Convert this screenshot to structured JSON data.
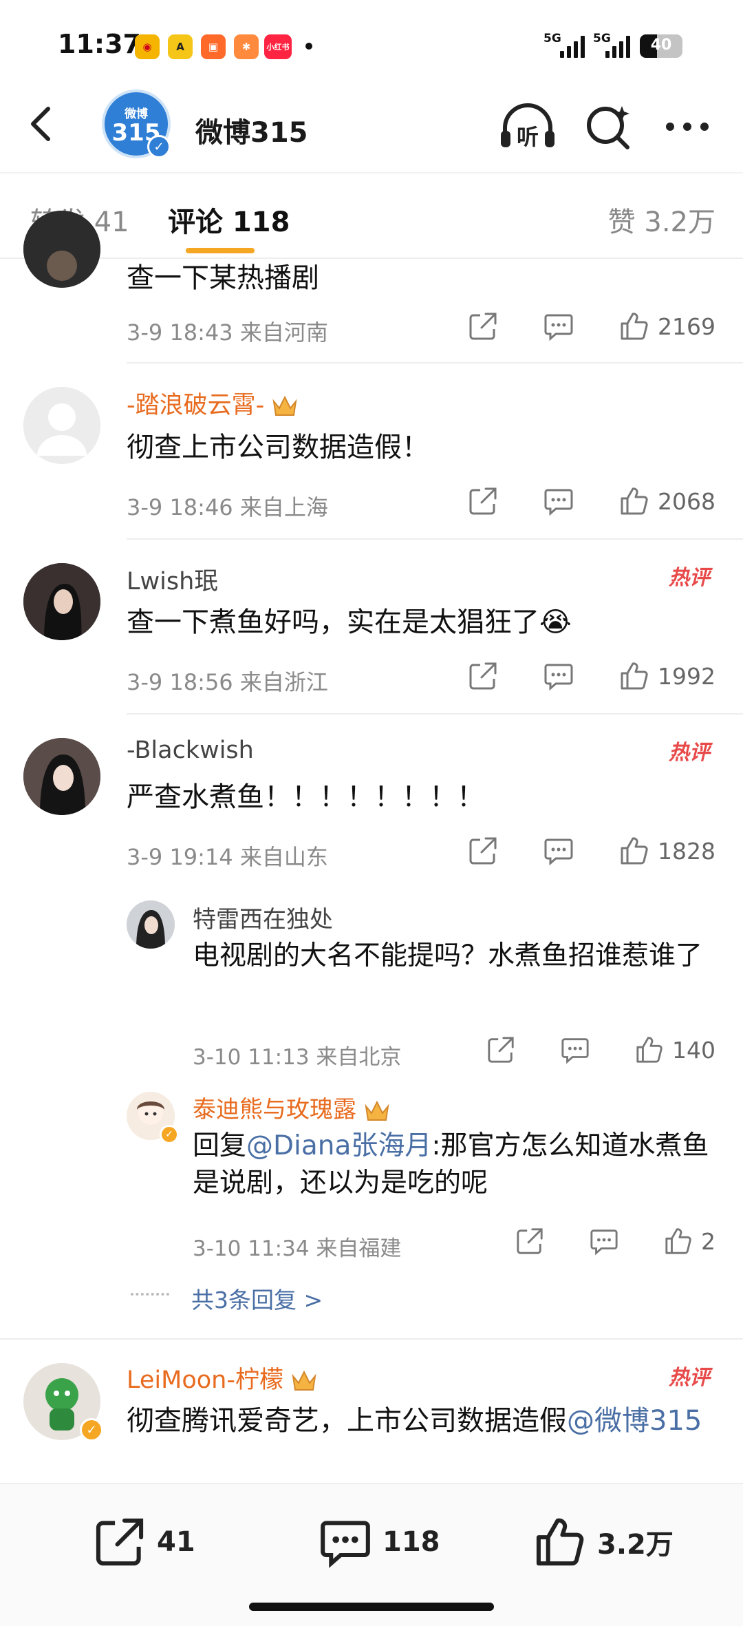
{
  "status_bar": {
    "time": "11:37",
    "sig1": "5G",
    "sig2": "5G",
    "battery": "40",
    "battery_level": 0.4,
    "mini_app_label": "小红书"
  },
  "nav": {
    "title": "微博315",
    "badge_line1": "微博",
    "badge_line2": "315",
    "icons": [
      "back-icon",
      "headphones-listen-icon",
      "search-sparkle-icon",
      "more-icon"
    ],
    "listen_label": "听"
  },
  "tabs": {
    "repost": "转发 41",
    "comment": "评论 118",
    "likes": "赞 3.2万"
  },
  "comments": [
    {
      "name": "",
      "text": "查一下某热播剧",
      "meta": "3-9 18:43  来自河南",
      "likes": "2169",
      "hot": false
    },
    {
      "name": "-踏浪破云霄-",
      "text": "彻查上市公司数据造假！",
      "meta": "3-9 18:46  来自上海",
      "likes": "2068",
      "hot": false
    },
    {
      "name": "Lwish珉",
      "text": "查一下煮鱼好吗，实在是太猖狂了😭",
      "meta": "3-9 18:56  来自浙江",
      "likes": "1992",
      "hot": true
    },
    {
      "name": "-Blackwish",
      "text": "严查水煮鱼！！！！！！！！",
      "meta": "3-9 19:14  来自山东",
      "likes": "1828",
      "hot": true
    },
    {
      "name": "LeiMoon-柠檬",
      "text_prefix": "彻查腾讯爱奇艺，上市公司数据造假",
      "text_mention": "@微博315",
      "hot": true
    }
  ],
  "replies": [
    {
      "name": "特雷西在独处",
      "text": "电视剧的大名不能提吗？水煮鱼招谁惹谁了",
      "meta": "3-10 11:13  来自北京",
      "likes": "140"
    },
    {
      "name": "泰迪熊与玫瑰露",
      "reply_prefix": "回复",
      "mention": "@Diana张海月",
      "text": ":那官方怎么知道水煮鱼是说剧，还以为是吃的呢",
      "meta": "3-10 11:34  来自福建",
      "likes": "2"
    }
  ],
  "hot_label": "热评",
  "more_replies": "共3条回复 >",
  "bottom_bar": {
    "repost": "41",
    "comment": "118",
    "like": "3.2万"
  }
}
